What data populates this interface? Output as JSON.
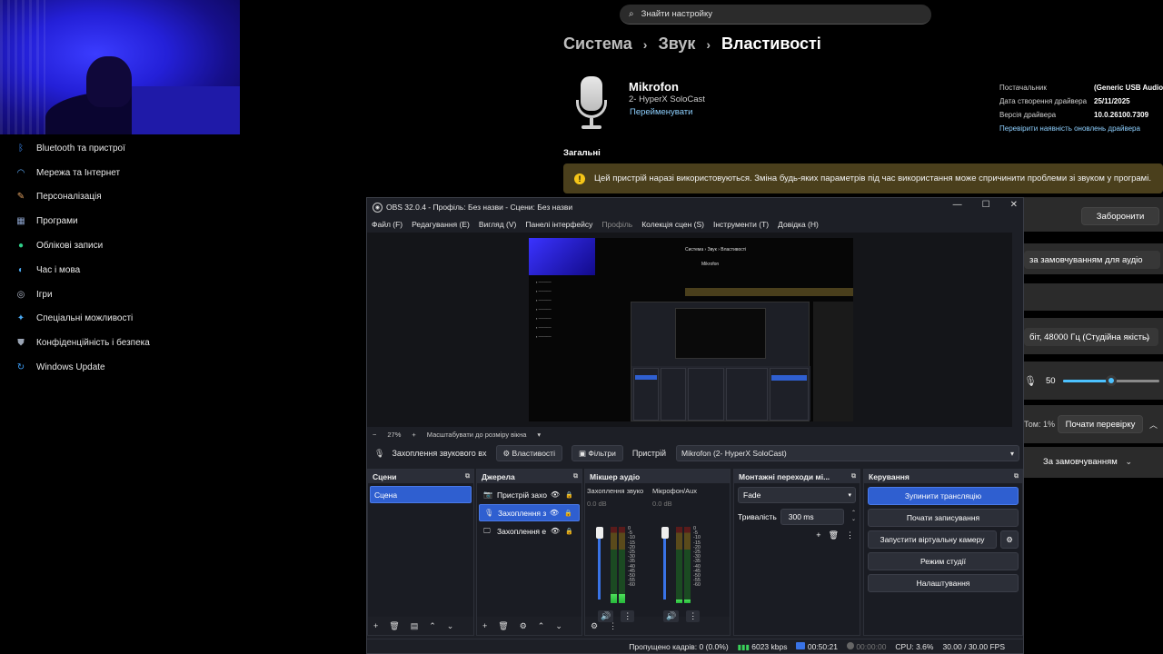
{
  "settings": {
    "search": {
      "placeholder": "Знайти настройку"
    },
    "breadcrumb": [
      "Система",
      "Звук",
      "Властивості"
    ],
    "sidebar": {
      "items": [
        {
          "label": "Bluetooth та пристрої",
          "icon": "bluetooth-icon",
          "color": "#3b8bf5"
        },
        {
          "label": "Мережа та Інтернет",
          "icon": "wifi-icon",
          "color": "#5fb0ff"
        },
        {
          "label": "Персоналізація",
          "icon": "brush-icon",
          "color": "#e0a060"
        },
        {
          "label": "Програми",
          "icon": "apps-icon",
          "color": "#8aa0c8"
        },
        {
          "label": "Облікові записи",
          "icon": "account-icon",
          "color": "#2fcf8a"
        },
        {
          "label": "Час і мова",
          "icon": "globe-icon",
          "color": "#4aa8f0"
        },
        {
          "label": "Ігри",
          "icon": "gamepad-icon",
          "color": "#b0b8c8"
        },
        {
          "label": "Спеціальні можливості",
          "icon": "accessibility-icon",
          "color": "#4aa8f0"
        },
        {
          "label": "Конфіденційність і безпека",
          "icon": "shield-icon",
          "color": "#9aa4b4"
        },
        {
          "label": "Windows Update",
          "icon": "update-icon",
          "color": "#3b9cf5"
        }
      ]
    },
    "device": {
      "name": "Mikrofon",
      "subtitle": "2- HyperX SoloCast",
      "rename": "Перейменувати"
    },
    "properties": [
      {
        "key": "Постачальник",
        "value": "(Generic USB Audio)"
      },
      {
        "key": "Дата створення драйвера",
        "value": "25/11/2025"
      },
      {
        "key": "Версія драйвера",
        "value": "10.0.26100.7309"
      }
    ],
    "driver_link": "Перевірити наявність оновлень драйвера",
    "general_heading": "Загальні",
    "warning": "Цей пристрій наразі використовуються. Зміна будь-яких параметрів під час використання може спричинити проблеми зі звуком у програмі.",
    "deny_button": "Заборонити",
    "default_format_dropdown": "за замовчуванням для аудіо",
    "format_dropdown": "біт, 48000 Гц (Студійна якість)",
    "volume_value": "50",
    "volume_level": 50,
    "test_label": "Том: 1%",
    "test_button": "Почати перевірку",
    "default_dropdown": "За замовчуванням"
  },
  "obs": {
    "title": "OBS 32.0.4 - Профіль: Без назви - Сцени: Без назви",
    "menu": [
      {
        "label": "Файл (F)",
        "disabled": false
      },
      {
        "label": "Редагування (E)",
        "disabled": false
      },
      {
        "label": "Вигляд (V)",
        "disabled": false
      },
      {
        "label": "Панелі інтерфейсу",
        "disabled": false
      },
      {
        "label": "Профіль",
        "disabled": true
      },
      {
        "label": "Колекція сцен (S)",
        "disabled": false
      },
      {
        "label": "Інструменти (T)",
        "disabled": false
      },
      {
        "label": "Довідка (H)",
        "disabled": false
      }
    ],
    "zoom": {
      "minus": "−",
      "value": "27%",
      "plus": "+",
      "fit": "Масштабувати до розміру вікна"
    },
    "source_bar": {
      "source": "Захоплення звукового вх",
      "properties": "Властивості",
      "filters": "Фільтри",
      "device_label": "Пристрій",
      "device_value": "Mikrofon (2- HyperX SoloCast)"
    },
    "scenes": {
      "title": "Сцени",
      "items": [
        "Сцена"
      ]
    },
    "sources": {
      "title": "Джерела",
      "items": [
        {
          "label": "Пристрій захо",
          "icon": "camera-icon",
          "selected": false
        },
        {
          "label": "Захоплення з",
          "icon": "mic-icon",
          "selected": true
        },
        {
          "label": "Захоплення е",
          "icon": "monitor-icon",
          "selected": false
        }
      ]
    },
    "mixer": {
      "title": "Мікшер аудіо",
      "channels": [
        {
          "name": "Захоплення звуко",
          "db": "0.0 dB",
          "level": 0.12
        },
        {
          "name": "Мікрофон/Aux",
          "db": "0.0 dB",
          "level": 0.05
        }
      ],
      "scale": [
        "0",
        "-5",
        "-10",
        "-15",
        "-20",
        "-25",
        "-30",
        "-35",
        "-40",
        "-45",
        "-50",
        "-55",
        "-60"
      ]
    },
    "transitions": {
      "title": "Монтажні переходи мі...",
      "selected": "Fade",
      "duration_label": "Тривалість",
      "duration_value": "300 ms"
    },
    "controls": {
      "title": "Керування",
      "stop_stream": "Зупинити трансляцію",
      "start_recording": "Почати записування",
      "virtual_cam": "Запустити віртуальну камеру",
      "studio_mode": "Режим студії",
      "settings": "Налаштування"
    },
    "status": {
      "dropped": "Пропущено кадрів: 0 (0.0%)",
      "bitrate": "6023 kbps",
      "stream_time": "00:50:21",
      "rec_time": "00:00:00",
      "cpu": "CPU: 3.6%",
      "fps": "30.00 / 30.00 FPS"
    },
    "preview_mini": {
      "crumb": "Система  ›  Звук  ›  Властивості",
      "device": "Mikrofon"
    }
  }
}
